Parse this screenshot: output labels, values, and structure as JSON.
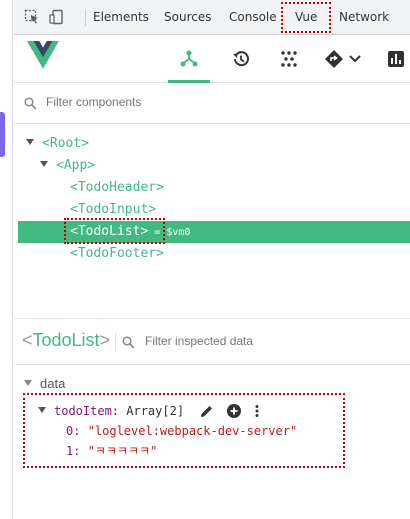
{
  "devtools": {
    "tabs": [
      "Elements",
      "Sources",
      "Console",
      "Vue",
      "Network"
    ],
    "active_tab": "Vue"
  },
  "filter_components": {
    "placeholder": "Filter components"
  },
  "tree": {
    "root": "<Root>",
    "app": "<App>",
    "children": [
      "<TodoHeader>",
      "<TodoInput>",
      "<TodoList>",
      "<TodoFooter>"
    ],
    "selected": "<TodoList>",
    "selected_suffix": "= $vm0"
  },
  "inspector": {
    "title_open": "<",
    "title_name": "TodoList",
    "title_close": ">",
    "filter_placeholder": "Filter inspected data",
    "section": "data",
    "prop_key": "todoItem",
    "prop_type": ": Array[2]",
    "items": [
      {
        "index": "0:",
        "value": "\"loglevel:webpack-dev-server\""
      },
      {
        "index": "1:",
        "value": "\"ㅋㅋㅋㅋㅋ\""
      }
    ]
  },
  "colors": {
    "vue_green": "#42b983",
    "annotation_red": "#c00000",
    "left_accent": "#7b68ee"
  },
  "icons": [
    "cursor-select-icon",
    "device-toggle-icon",
    "vue-logo",
    "components-tree-icon",
    "history-icon",
    "vuex-icon",
    "router-icon",
    "chevron-down-icon",
    "performance-icon",
    "search-icon",
    "edit-icon",
    "add-icon",
    "more-vertical-icon"
  ]
}
